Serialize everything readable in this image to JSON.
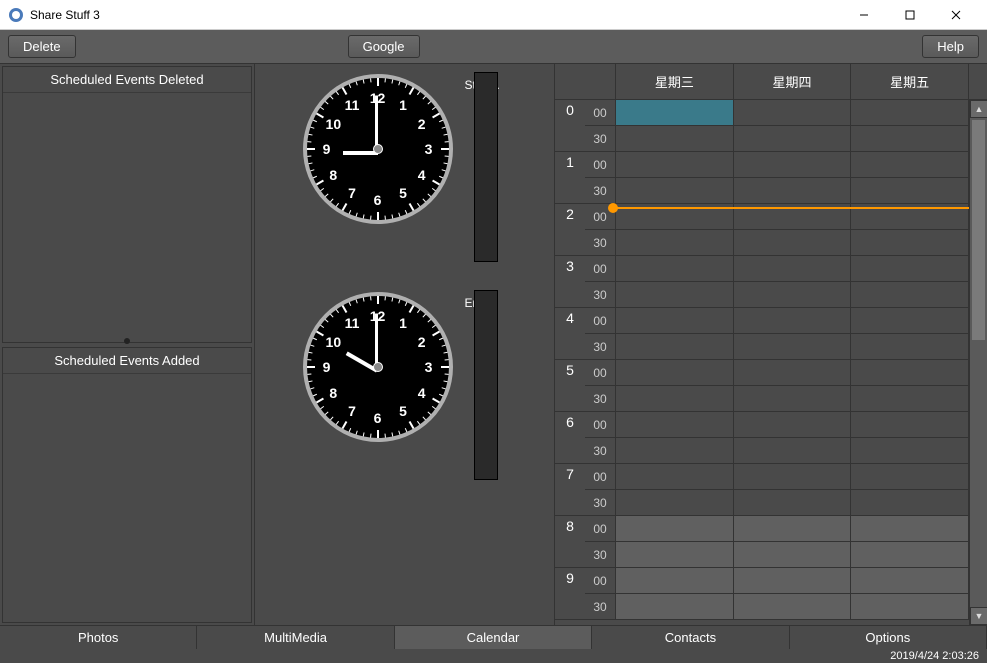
{
  "window": {
    "title": "Share Stuff 3"
  },
  "toolbar": {
    "delete_label": "Delete",
    "google_label": "Google",
    "help_label": "Help"
  },
  "panels": {
    "deleted_header": "Scheduled Events Deleted",
    "added_header": "Scheduled Events  Added"
  },
  "clocks": {
    "start_label": "Start...",
    "end_label": "End...",
    "start_time": {
      "hour": 9,
      "minute": 0
    },
    "end_time": {
      "hour": 10,
      "minute": 0
    },
    "numbers": [
      "12",
      "1",
      "2",
      "3",
      "4",
      "5",
      "6",
      "7",
      "8",
      "9",
      "10",
      "11"
    ]
  },
  "calendar": {
    "days": [
      "星期三",
      "星期四",
      "星期五"
    ],
    "hours": [
      "0",
      "1",
      "2",
      "3",
      "4",
      "5",
      "6",
      "7",
      "8",
      "9"
    ],
    "minutes_labels": [
      "00",
      "30"
    ],
    "now_hour": 2,
    "now_minute": 3,
    "selected": {
      "day": 0,
      "hour": 0,
      "half": 0
    },
    "off_hours_start": 8
  },
  "tabs": {
    "items": [
      "Photos",
      "MultiMedia",
      "Calendar",
      "Contacts",
      "Options"
    ],
    "active": 2
  },
  "status": {
    "datetime": "2019/4/24 2:03:26"
  }
}
